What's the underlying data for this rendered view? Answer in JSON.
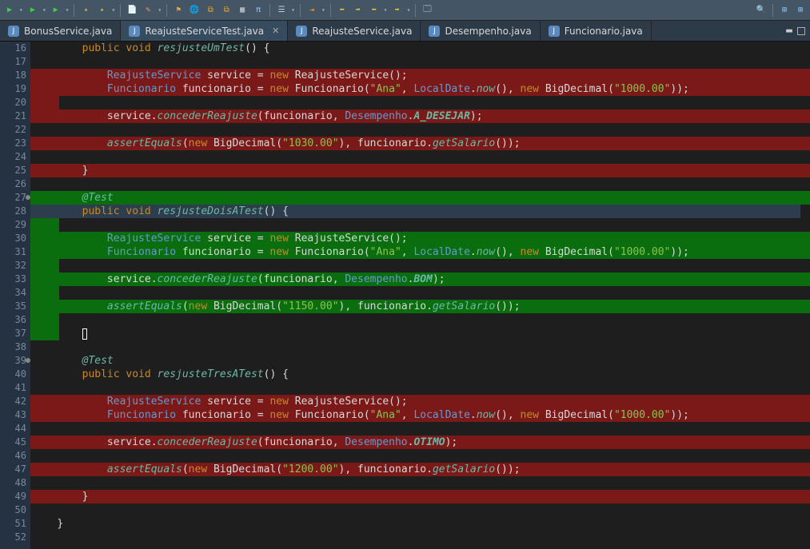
{
  "toolbar": {
    "icons": [
      "run",
      "run2",
      "run3",
      "new",
      "save",
      "saveall",
      "edit",
      "highlight",
      "settings",
      "cut",
      "copy",
      "paste",
      "align",
      "list",
      "indent",
      "nav",
      "back",
      "fwd",
      "back2",
      "fwd2",
      "ext"
    ],
    "search_tooltip": "Search",
    "right_icons": [
      "perspective1",
      "perspective2"
    ]
  },
  "tabs": [
    {
      "label": "BonusService.java",
      "active": false
    },
    {
      "label": "ReajusteServiceTest.java",
      "active": true,
      "closeable": true
    },
    {
      "label": "ReajusteService.java",
      "active": false
    },
    {
      "label": "Desempenho.java",
      "active": false
    },
    {
      "label": "Funcionario.java",
      "active": false
    }
  ],
  "gutter": {
    "start": 16,
    "end": 52,
    "markers": [
      27,
      39
    ]
  },
  "lines": {
    "l16": {
      "kind": "plain",
      "indent": 2,
      "tokens": [
        [
          "k",
          "public"
        ],
        [
          " "
        ],
        [
          "k",
          "void"
        ],
        [
          " "
        ],
        [
          "meth",
          "resjusteUmTest"
        ],
        [
          "op",
          "() {"
        ]
      ]
    },
    "l17": {
      "kind": "plain",
      "tokens": []
    },
    "l18": {
      "kind": "red",
      "indent": 3,
      "tokens": [
        [
          "type",
          "ReajusteService"
        ],
        [
          " "
        ],
        [
          "id",
          "service"
        ],
        [
          " "
        ],
        [
          "op",
          "="
        ],
        [
          " "
        ],
        [
          "k",
          "new"
        ],
        [
          " "
        ],
        [
          "id",
          "ReajusteService"
        ],
        [
          "op",
          "();"
        ]
      ]
    },
    "l19": {
      "kind": "red",
      "indent": 3,
      "tokens": [
        [
          "type",
          "Funcionario"
        ],
        [
          " "
        ],
        [
          "id",
          "funcionario"
        ],
        [
          " "
        ],
        [
          "op",
          "="
        ],
        [
          " "
        ],
        [
          "k",
          "new"
        ],
        [
          " "
        ],
        [
          "id",
          "Funcionario"
        ],
        [
          "op",
          "("
        ],
        [
          "str",
          "\"Ana\""
        ],
        [
          "op",
          ", "
        ],
        [
          "type",
          "LocalDate"
        ],
        [
          "op",
          "."
        ],
        [
          "meth",
          "now"
        ],
        [
          "op",
          "(), "
        ],
        [
          "k",
          "new"
        ],
        [
          " "
        ],
        [
          "id",
          "BigDecimal"
        ],
        [
          "op",
          "("
        ],
        [
          "str",
          "\"1000.00\""
        ],
        [
          "op",
          "));"
        ]
      ]
    },
    "l20": {
      "kind": "red-empty",
      "tokens": []
    },
    "l21": {
      "kind": "red",
      "indent": 3,
      "tokens": [
        [
          "id",
          "service."
        ],
        [
          "meth",
          "concederReajuste"
        ],
        [
          "op",
          "("
        ],
        [
          "id",
          "funcionario"
        ],
        [
          "op",
          ", "
        ],
        [
          "type",
          "Desempenho"
        ],
        [
          "op",
          "."
        ],
        [
          "const",
          "A_DESEJAR"
        ],
        [
          "op",
          ");"
        ]
      ]
    },
    "l22": {
      "kind": "plain",
      "tokens": []
    },
    "l23": {
      "kind": "red",
      "indent": 3,
      "tokens": [
        [
          "assert",
          "assertEquals"
        ],
        [
          "op",
          "("
        ],
        [
          "k",
          "new"
        ],
        [
          " "
        ],
        [
          "id",
          "BigDecimal"
        ],
        [
          "op",
          "("
        ],
        [
          "str",
          "\"1030.00\""
        ],
        [
          "op",
          "), "
        ],
        [
          "id",
          "funcionario."
        ],
        [
          "meth",
          "getSalario"
        ],
        [
          "op",
          "());"
        ]
      ]
    },
    "l24": {
      "kind": "plain",
      "tokens": []
    },
    "l25": {
      "kind": "red",
      "indent": 2,
      "tokens": [
        [
          "op",
          "}"
        ]
      ]
    },
    "l26": {
      "kind": "plain",
      "tokens": []
    },
    "l27": {
      "kind": "green",
      "indent": 2,
      "tokens": [
        [
          "ann",
          "@Test"
        ]
      ]
    },
    "l28": {
      "kind": "cursor",
      "indent": 2,
      "tokens": [
        [
          "k",
          "public"
        ],
        [
          " "
        ],
        [
          "k",
          "void"
        ],
        [
          " "
        ],
        [
          "meth",
          "resjusteDoisATest"
        ],
        [
          "op",
          "() {"
        ]
      ]
    },
    "l29": {
      "kind": "green",
      "tokens": []
    },
    "l30": {
      "kind": "green",
      "indent": 3,
      "tokens": [
        [
          "type",
          "ReajusteService"
        ],
        [
          " "
        ],
        [
          "id",
          "service"
        ],
        [
          " "
        ],
        [
          "op",
          "="
        ],
        [
          " "
        ],
        [
          "k",
          "new"
        ],
        [
          " "
        ],
        [
          "id",
          "ReajusteService"
        ],
        [
          "op",
          "();"
        ]
      ]
    },
    "l31": {
      "kind": "green",
      "indent": 3,
      "tokens": [
        [
          "type",
          "Funcionario"
        ],
        [
          " "
        ],
        [
          "id",
          "funcionario"
        ],
        [
          " "
        ],
        [
          "op",
          "="
        ],
        [
          " "
        ],
        [
          "k",
          "new"
        ],
        [
          " "
        ],
        [
          "id",
          "Funcionario"
        ],
        [
          "op",
          "("
        ],
        [
          "str",
          "\"Ana\""
        ],
        [
          "op",
          ", "
        ],
        [
          "type",
          "LocalDate"
        ],
        [
          "op",
          "."
        ],
        [
          "meth",
          "now"
        ],
        [
          "op",
          "(), "
        ],
        [
          "k",
          "new"
        ],
        [
          " "
        ],
        [
          "id",
          "BigDecimal"
        ],
        [
          "op",
          "("
        ],
        [
          "str",
          "\"1000.00\""
        ],
        [
          "op",
          "));"
        ]
      ]
    },
    "l32": {
      "kind": "green",
      "tokens": []
    },
    "l33": {
      "kind": "green",
      "indent": 3,
      "tokens": [
        [
          "id",
          "service."
        ],
        [
          "meth",
          "concederReajuste"
        ],
        [
          "op",
          "("
        ],
        [
          "id",
          "funcionario"
        ],
        [
          "op",
          ", "
        ],
        [
          "type",
          "Desempenho"
        ],
        [
          "op",
          "."
        ],
        [
          "const",
          "BOM"
        ],
        [
          "op",
          ");"
        ]
      ]
    },
    "l34": {
      "kind": "green",
      "tokens": []
    },
    "l35": {
      "kind": "green",
      "indent": 3,
      "tokens": [
        [
          "assert",
          "assertEquals"
        ],
        [
          "op",
          "("
        ],
        [
          "k",
          "new"
        ],
        [
          " "
        ],
        [
          "id",
          "BigDecimal"
        ],
        [
          "op",
          "("
        ],
        [
          "str",
          "\"1150.00\""
        ],
        [
          "op",
          "), "
        ],
        [
          "id",
          "funcionario."
        ],
        [
          "meth",
          "getSalario"
        ],
        [
          "op",
          "());"
        ]
      ]
    },
    "l36": {
      "kind": "green",
      "tokens": []
    },
    "l37": {
      "kind": "green-caret",
      "indent": 2,
      "tokens": []
    },
    "l38": {
      "kind": "plain",
      "tokens": []
    },
    "l39": {
      "kind": "plain",
      "indent": 2,
      "tokens": [
        [
          "ann",
          "@Test"
        ]
      ]
    },
    "l40": {
      "kind": "plain",
      "indent": 2,
      "tokens": [
        [
          "k",
          "public"
        ],
        [
          " "
        ],
        [
          "k",
          "void"
        ],
        [
          " "
        ],
        [
          "meth",
          "resjusteTresATest"
        ],
        [
          "op",
          "() {"
        ]
      ]
    },
    "l41": {
      "kind": "plain",
      "tokens": []
    },
    "l42": {
      "kind": "red",
      "indent": 3,
      "tokens": [
        [
          "type",
          "ReajusteService"
        ],
        [
          " "
        ],
        [
          "id",
          "service"
        ],
        [
          " "
        ],
        [
          "op",
          "="
        ],
        [
          " "
        ],
        [
          "k",
          "new"
        ],
        [
          " "
        ],
        [
          "id",
          "ReajusteService"
        ],
        [
          "op",
          "();"
        ]
      ]
    },
    "l43": {
      "kind": "red",
      "indent": 3,
      "tokens": [
        [
          "type",
          "Funcionario"
        ],
        [
          " "
        ],
        [
          "id",
          "funcionario"
        ],
        [
          " "
        ],
        [
          "op",
          "="
        ],
        [
          " "
        ],
        [
          "k",
          "new"
        ],
        [
          " "
        ],
        [
          "id",
          "Funcionario"
        ],
        [
          "op",
          "("
        ],
        [
          "str",
          "\"Ana\""
        ],
        [
          "op",
          ", "
        ],
        [
          "type",
          "LocalDate"
        ],
        [
          "op",
          "."
        ],
        [
          "meth",
          "now"
        ],
        [
          "op",
          "(), "
        ],
        [
          "k",
          "new"
        ],
        [
          " "
        ],
        [
          "id",
          "BigDecimal"
        ],
        [
          "op",
          "("
        ],
        [
          "str",
          "\"1000.00\""
        ],
        [
          "op",
          "));"
        ]
      ]
    },
    "l44": {
      "kind": "plain",
      "tokens": []
    },
    "l45": {
      "kind": "red",
      "indent": 3,
      "tokens": [
        [
          "id",
          "service."
        ],
        [
          "meth",
          "concederReajuste"
        ],
        [
          "op",
          "("
        ],
        [
          "id",
          "funcionario"
        ],
        [
          "op",
          ", "
        ],
        [
          "type",
          "Desempenho"
        ],
        [
          "op",
          "."
        ],
        [
          "const",
          "OTIMO"
        ],
        [
          "op",
          ");"
        ]
      ]
    },
    "l46": {
      "kind": "plain",
      "tokens": []
    },
    "l47": {
      "kind": "red",
      "indent": 3,
      "tokens": [
        [
          "assert",
          "assertEquals"
        ],
        [
          "op",
          "("
        ],
        [
          "k",
          "new"
        ],
        [
          " "
        ],
        [
          "id",
          "BigDecimal"
        ],
        [
          "op",
          "("
        ],
        [
          "str",
          "\"1200.00\""
        ],
        [
          "op",
          "), "
        ],
        [
          "id",
          "funcionario."
        ],
        [
          "meth",
          "getSalario"
        ],
        [
          "op",
          "());"
        ]
      ]
    },
    "l48": {
      "kind": "plain",
      "tokens": []
    },
    "l49": {
      "kind": "red",
      "indent": 2,
      "tokens": [
        [
          "op",
          "}"
        ]
      ]
    },
    "l50": {
      "kind": "plain",
      "tokens": []
    },
    "l51": {
      "kind": "plain",
      "indent": 1,
      "tokens": [
        [
          "op",
          "}"
        ]
      ]
    },
    "l52": {
      "kind": "plain",
      "tokens": []
    }
  }
}
